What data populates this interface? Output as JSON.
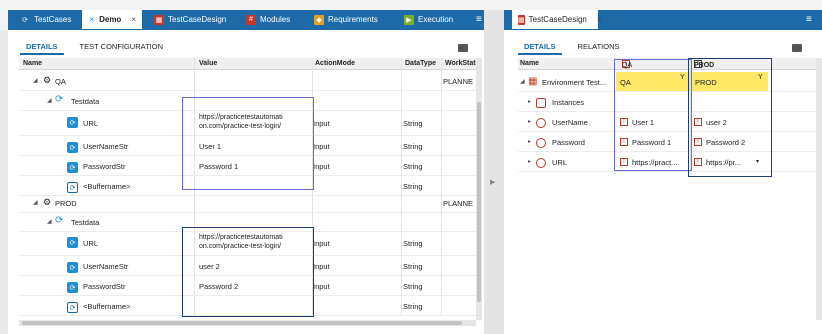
{
  "left_tabs": [
    {
      "label": "TestCases",
      "icon": "refresh-icon",
      "color": "#1e8fd0"
    },
    {
      "label": "Demo",
      "icon": "test-icon",
      "color": "#1e8fd0"
    },
    {
      "label": "TestCaseDesign",
      "icon": "table-icon",
      "color": "#c0392b"
    },
    {
      "label": "Modules",
      "icon": "module-icon",
      "color": "#c0392b"
    },
    {
      "label": "Requirements",
      "icon": "requirement-icon",
      "color": "#e0a020"
    },
    {
      "label": "Execution",
      "icon": "execution-icon",
      "color": "#7ab02a"
    }
  ],
  "right_tab": {
    "label": "TestCaseDesign"
  },
  "close_glyph": "×",
  "overflow_glyph": "≡",
  "left_subtabs": [
    "DETAILS",
    "TEST CONFIGURATION"
  ],
  "right_subtabs": [
    "DETAILS",
    "RELATIONS"
  ],
  "left_columns": [
    "Name",
    "Value",
    "ActionMode",
    "DataType",
    "WorkState"
  ],
  "left_rows": [
    {
      "name": "QA",
      "value": "",
      "mode": "",
      "type": "",
      "state": "PLANNE"
    },
    {
      "name": "Testdata",
      "value": "",
      "mode": "",
      "type": "",
      "state": ""
    },
    {
      "name": "URL",
      "value1": "https://practicetestautomati",
      "value2": "on.com/practice-test-login/",
      "mode": "Input",
      "type": "String",
      "state": ""
    },
    {
      "name": "UserNameStr",
      "value": "User 1",
      "mode": "Input",
      "type": "String",
      "state": ""
    },
    {
      "name": "PasswordStr",
      "value": "Password 1",
      "mode": "Input",
      "type": "String",
      "state": ""
    },
    {
      "name": "<Buffername>",
      "value": "",
      "mode": "",
      "type": "String",
      "state": ""
    },
    {
      "name": "PROD",
      "value": "",
      "mode": "",
      "type": "",
      "state": "PLANNE"
    },
    {
      "name": "Testdata",
      "value": "",
      "mode": "",
      "type": "",
      "state": ""
    },
    {
      "name": "URL",
      "value1": "https://practicetestautomati",
      "value2": "on.com/practice-test-login/",
      "mode": "Input",
      "type": "String",
      "state": ""
    },
    {
      "name": "UserNameStr",
      "value": "user 2",
      "mode": "Input",
      "type": "String",
      "state": ""
    },
    {
      "name": "PasswordStr",
      "value": "Password 2",
      "mode": "Input",
      "type": "String",
      "state": ""
    },
    {
      "name": "<Buffername>",
      "value": "",
      "mode": "",
      "type": "String",
      "state": ""
    }
  ],
  "right_columns": {
    "name": "Name",
    "qa": "QA",
    "prod": "PROD"
  },
  "right_rows": [
    {
      "name": "Environment Test...",
      "qa": "QA",
      "prod": "PROD"
    },
    {
      "name": "Instances",
      "qa": "",
      "prod": ""
    },
    {
      "name": "UserName",
      "qa": "User 1",
      "prod": "user 2"
    },
    {
      "name": "Password",
      "qa": "Password 1",
      "prod": "Password 2"
    },
    {
      "name": "URL",
      "qa": "https://pract...",
      "prod": "https://pr..."
    }
  ],
  "colors": {
    "tab_blue": "#1e6aa8",
    "highlight_yellow": "#ffe866"
  }
}
